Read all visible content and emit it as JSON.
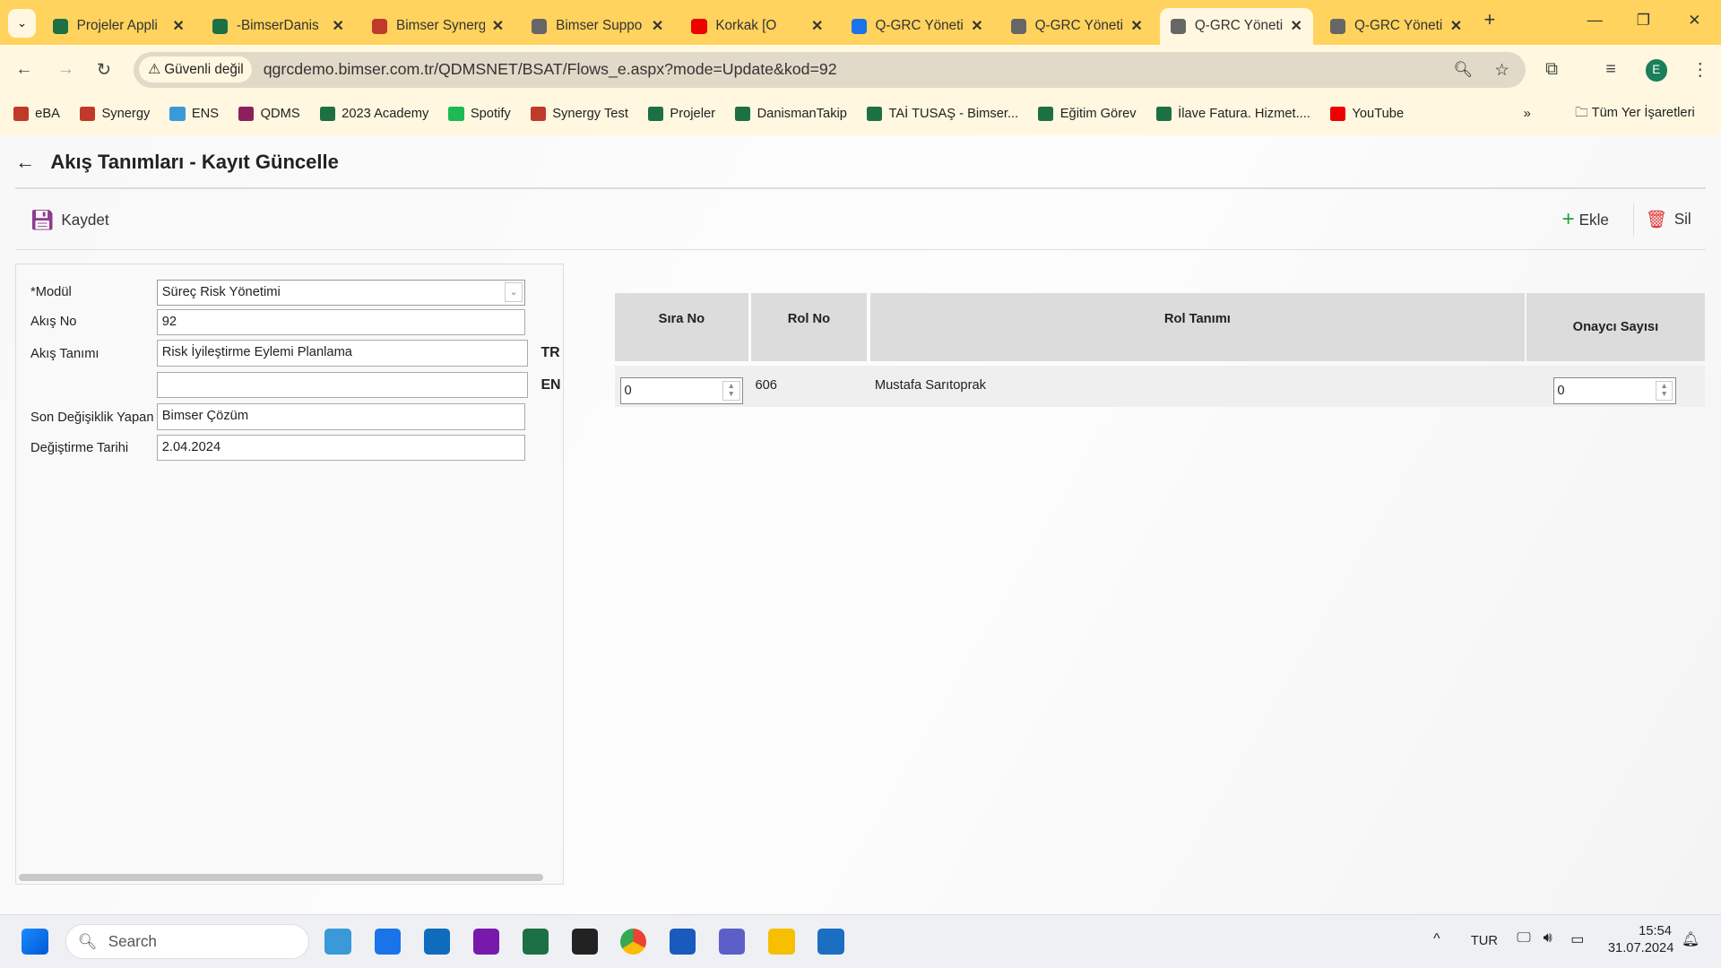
{
  "browser": {
    "tabs": [
      {
        "title": "Projeler Appli",
        "icon": "excel-icon",
        "color": "#1d7044"
      },
      {
        "title": "-BimserDanis",
        "icon": "excel-icon",
        "color": "#1d7044"
      },
      {
        "title": "Bimser Synerg",
        "icon": "synergy-icon",
        "color": "#c0392b"
      },
      {
        "title": "Bimser Suppo",
        "icon": "globe-icon",
        "color": "#666"
      },
      {
        "title": "Korkak [O",
        "icon": "youtube-icon",
        "color": "#e00"
      },
      {
        "title": "Q-GRC Yöneti",
        "icon": "qgrc-icon",
        "color": "#1a73e8"
      },
      {
        "title": "Q-GRC Yöneti",
        "icon": "globe-icon",
        "color": "#666"
      },
      {
        "title": "Q-GRC Yöneti",
        "icon": "globe-icon",
        "color": "#666",
        "active": true
      },
      {
        "title": "Q-GRC Yöneti",
        "icon": "globe-icon",
        "color": "#666"
      }
    ],
    "security_label": "Güvenli değil",
    "url": "qgrcdemo.bimser.com.tr/QDMSNET/BSAT/Flows_e.aspx?mode=Update&kod=92",
    "profile_initial": "E",
    "bookmarks": [
      {
        "label": "eBA",
        "color": "#c0392b"
      },
      {
        "label": "Synergy",
        "color": "#c0392b"
      },
      {
        "label": "ENS",
        "color": "#3a9ad9"
      },
      {
        "label": "QDMS",
        "color": "#8e1f5c"
      },
      {
        "label": "2023 Academy",
        "color": "#1d7044"
      },
      {
        "label": "Spotify",
        "color": "#1db954"
      },
      {
        "label": "Synergy Test",
        "color": "#c0392b"
      },
      {
        "label": "Projeler",
        "color": "#1d7044"
      },
      {
        "label": "DanismanTakip",
        "color": "#1d7044"
      },
      {
        "label": "TAİ TUSAŞ - Bimser...",
        "color": "#1d7044"
      },
      {
        "label": "Eğitim Görev",
        "color": "#1d7044"
      },
      {
        "label": "İlave Fatura. Hizmet....",
        "color": "#1d7044"
      },
      {
        "label": "YouTube",
        "color": "#e00"
      }
    ],
    "all_bookmarks": "Tüm Yer İşaretleri"
  },
  "page": {
    "title": "Akış Tanımları - Kayıt Güncelle",
    "save": "Kaydet",
    "add": "Ekle",
    "delete": "Sil",
    "form": {
      "module_label": "*Modül",
      "module_value": "Süreç Risk Yönetimi",
      "flow_no_label": "Akış No",
      "flow_no_value": "92",
      "flow_def_label": "Akış Tanımı",
      "flow_def_tr": "Risk İyileştirme Eylemi Planlama",
      "flow_def_en": "",
      "lang_tr": "TR",
      "lang_en": "EN",
      "modified_by_label": "Son Değişiklik Yapan",
      "modified_by_value": "Bimser Çözüm",
      "modified_date_label": "Değiştirme Tarihi",
      "modified_date_value": "2.04.2024"
    },
    "grid": {
      "headers": [
        "Sıra No",
        "Rol No",
        "Rol Tanımı",
        "Onaycı Sayısı"
      ],
      "rows": [
        {
          "order": "0",
          "role_no": "606",
          "role_def": "Mustafa Sarıtoprak",
          "approvers": "0"
        }
      ]
    }
  },
  "taskbar": {
    "search": "Search",
    "lang": "TUR",
    "time": "15:54",
    "date": "31.07.2024"
  }
}
